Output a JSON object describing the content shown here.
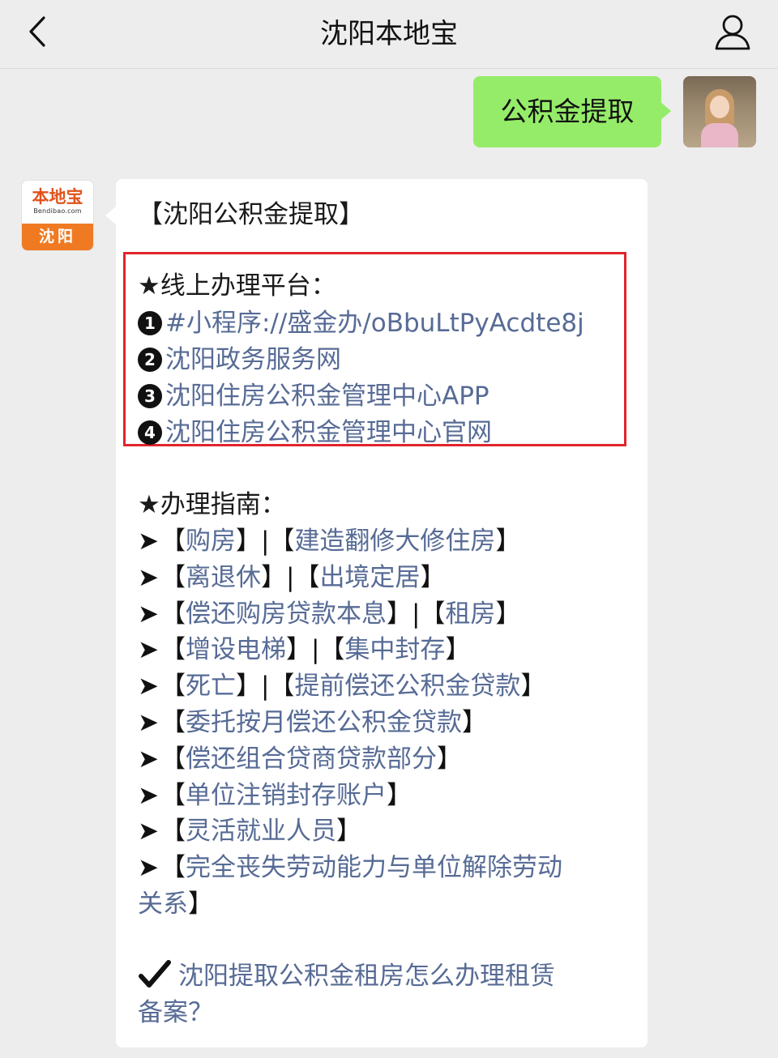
{
  "navbar": {
    "title": "沈阳本地宝"
  },
  "chat": {
    "outgoing": {
      "text": "公积金提取"
    },
    "sender_avatar": {
      "brand_name": "本地宝",
      "brand_url": "Bendibao.com",
      "city": "沈阳"
    },
    "reply": {
      "title": "【沈阳公积金提取】",
      "online_header": "★线上办理平台：",
      "platforms": [
        {
          "num": "1",
          "text": "#小程序://盛金办/oBbuLtPyAcdte8j"
        },
        {
          "num": "2",
          "text": "沈阳政务服务网"
        },
        {
          "num": "3",
          "text": "沈阳住房公积金管理中心APP"
        },
        {
          "num": "4",
          "text": "沈阳住房公积金管理中心官网"
        }
      ],
      "guide_header": "★办理指南：",
      "guide": {
        "r1": {
          "a": "购房",
          "b": "建造翻修大修住房"
        },
        "r2": {
          "a": "离退休",
          "b": "出境定居"
        },
        "r3": {
          "a": "偿还购房贷款本息",
          "b": "租房"
        },
        "r4": {
          "a": "增设电梯",
          "b": "集中封存"
        },
        "r5": {
          "a": "死亡",
          "b": "提前偿还公积金贷款"
        },
        "r6": {
          "a": "委托按月偿还公积金贷款"
        },
        "r7": {
          "a": "偿还组合贷商贷款部分"
        },
        "r8": {
          "a": "单位注销封存账户"
        },
        "r9": {
          "a": "灵活就业人员"
        },
        "r10": {
          "a": "完全丧失劳动能力与单位解除劳动",
          "a2": "关系"
        }
      },
      "faq_line1": "沈阳提取公积金租房怎么办理租赁",
      "faq_line2": "备案？"
    }
  },
  "icons": {
    "back": "chevron-left-icon",
    "user": "user-icon",
    "faq": "check-mark-icon"
  },
  "colors": {
    "background": "#ededed",
    "outgoing_bubble": "#95ec69",
    "link": "#576b95",
    "highlight_box": "#e1242d",
    "brand_orange": "#f07a22"
  }
}
